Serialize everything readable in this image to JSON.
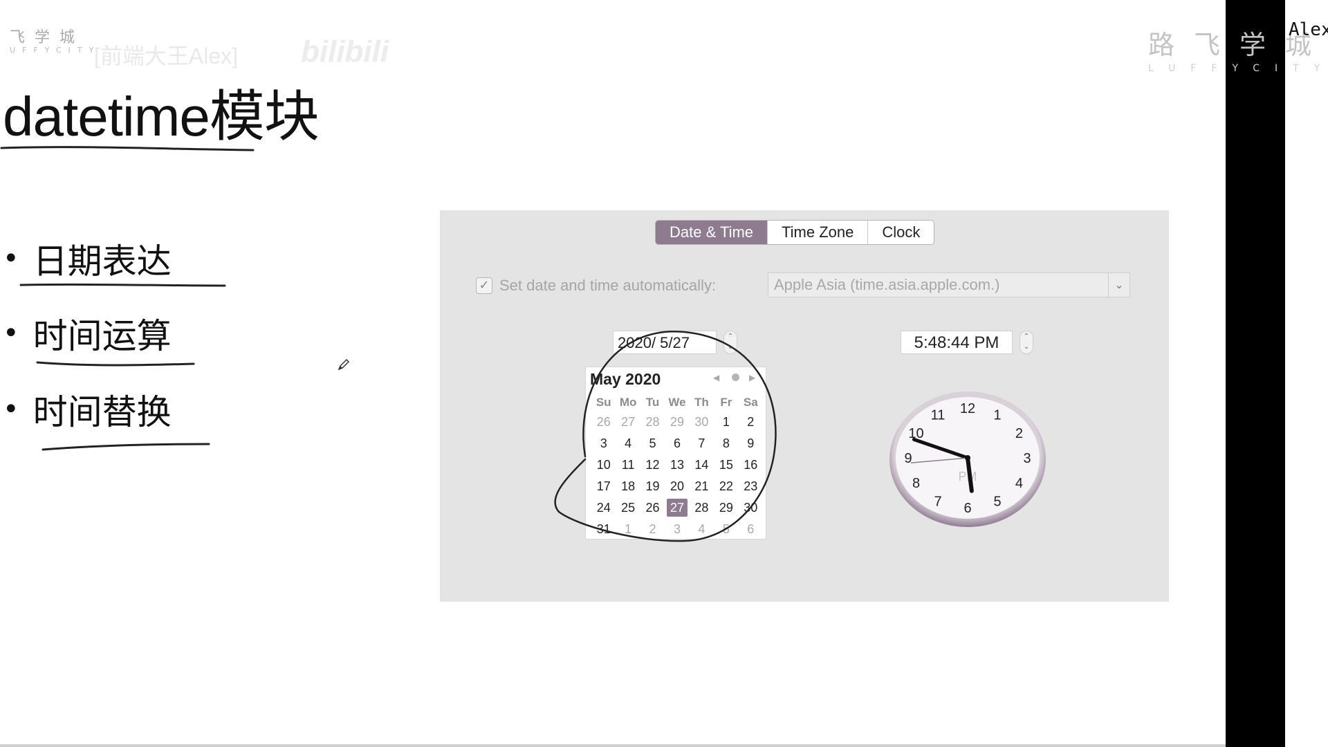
{
  "watermark_left": {
    "cn": "飞学城",
    "en": "UFFYCITY",
    "handle": "[前端大王Alex]",
    "site": "bilibili"
  },
  "watermark_right": {
    "cn": "路飞学城",
    "en": "LUFFYCITY"
  },
  "user_tag": "Alex",
  "slide": {
    "title": "datetime模块",
    "bullets": [
      "日期表达",
      "时间运算",
      "时间替换"
    ]
  },
  "prefs": {
    "tabs": [
      {
        "label": "Date & Time",
        "active": true
      },
      {
        "label": "Time Zone",
        "active": false
      },
      {
        "label": "Clock",
        "active": false
      }
    ],
    "auto_label": "Set date and time automatically:",
    "auto_checked": true,
    "server": "Apple Asia (time.asia.apple.com.)",
    "date_value": "2020/  5/27",
    "time_value": "5:48:44 PM",
    "calendar": {
      "month_label": "May 2020",
      "weekdays": [
        "Su",
        "Mo",
        "Tu",
        "We",
        "Th",
        "Fr",
        "Sa"
      ],
      "weeks": [
        [
          "26",
          "27",
          "28",
          "29",
          "30",
          "1",
          "2"
        ],
        [
          "3",
          "4",
          "5",
          "6",
          "7",
          "8",
          "9"
        ],
        [
          "10",
          "11",
          "12",
          "13",
          "14",
          "15",
          "16"
        ],
        [
          "17",
          "18",
          "19",
          "20",
          "21",
          "22",
          "23"
        ],
        [
          "24",
          "25",
          "26",
          "27",
          "28",
          "29",
          "30"
        ],
        [
          "31",
          "1",
          "2",
          "3",
          "4",
          "5",
          "6"
        ]
      ],
      "selected": "27"
    },
    "clock": {
      "numerals": [
        "12",
        "1",
        "2",
        "3",
        "4",
        "5",
        "6",
        "7",
        "8",
        "9",
        "10",
        "11"
      ],
      "meridiem": "PM",
      "hour": 5,
      "minute": 48,
      "second": 44,
      "accent": "#8e7b90"
    }
  }
}
